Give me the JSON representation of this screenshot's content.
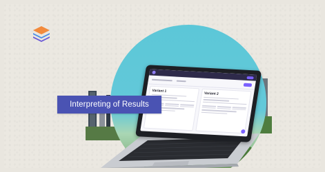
{
  "caption": {
    "text": "Interpreting of Results"
  },
  "screen": {
    "variant_1": "Variant 1",
    "variant_2": "Variant 2"
  },
  "icons": {
    "logo": "stacked-layers-logo-icon"
  },
  "colors": {
    "caption_bg": "#4a53b3",
    "sky": "#5cc7d8",
    "accent": "#7b61ff",
    "background": "#ebe8e1"
  }
}
